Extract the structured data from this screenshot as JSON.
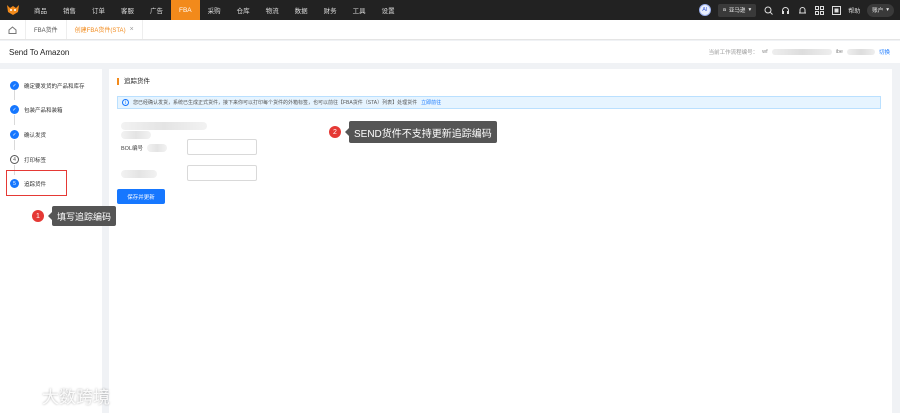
{
  "topnav": {
    "items": [
      "商品",
      "销售",
      "订单",
      "客服",
      "广告",
      "FBA",
      "采购",
      "仓库",
      "物流",
      "数据",
      "财务",
      "工具",
      "设置"
    ],
    "active_index": 5,
    "ai_label": "AI",
    "shop_select": "亚马逊",
    "help_label": "帮助",
    "account_label": "账户"
  },
  "tabs": {
    "items": [
      "FBA货件",
      "创建FBA货件(STA)"
    ],
    "active_index": 1
  },
  "page": {
    "title": "Send To Amazon",
    "flow_label": "当前工作流程编号：",
    "flow_prefix": "wf",
    "flow_suffix": "ibe",
    "switch_label": "切换"
  },
  "steps": [
    {
      "label": "确定要发货的产品和库存",
      "state": "done",
      "mark": "✓"
    },
    {
      "label": "包装产品和装箱",
      "state": "done",
      "mark": "✓"
    },
    {
      "label": "确认发货",
      "state": "done",
      "mark": "✓"
    },
    {
      "label": "打印标签",
      "state": "todo",
      "mark": "4"
    },
    {
      "label": "追踪货件",
      "state": "current",
      "mark": "5"
    }
  ],
  "main": {
    "section_title": "追踪货件",
    "banner_text": "您已经确认发货，系统已生成正式货件，接下来你可以打印每个货件的外箱标签，也可以前往【FBA货件（STA）列表】处理货件",
    "banner_link": "立即前往",
    "bol_label": "BOL编号",
    "save_button": "保存并更新"
  },
  "callouts": {
    "one": {
      "num": "1",
      "text": "填写追踪编码"
    },
    "two": {
      "num": "2",
      "text": "SEND货件不支持更新追踪编码"
    }
  },
  "watermark": "大数跨境",
  "colors": {
    "brand_orange": "#f28a1b",
    "primary_blue": "#1677ff",
    "annotation_red": "#e53935",
    "topbar_dark": "#222222"
  }
}
